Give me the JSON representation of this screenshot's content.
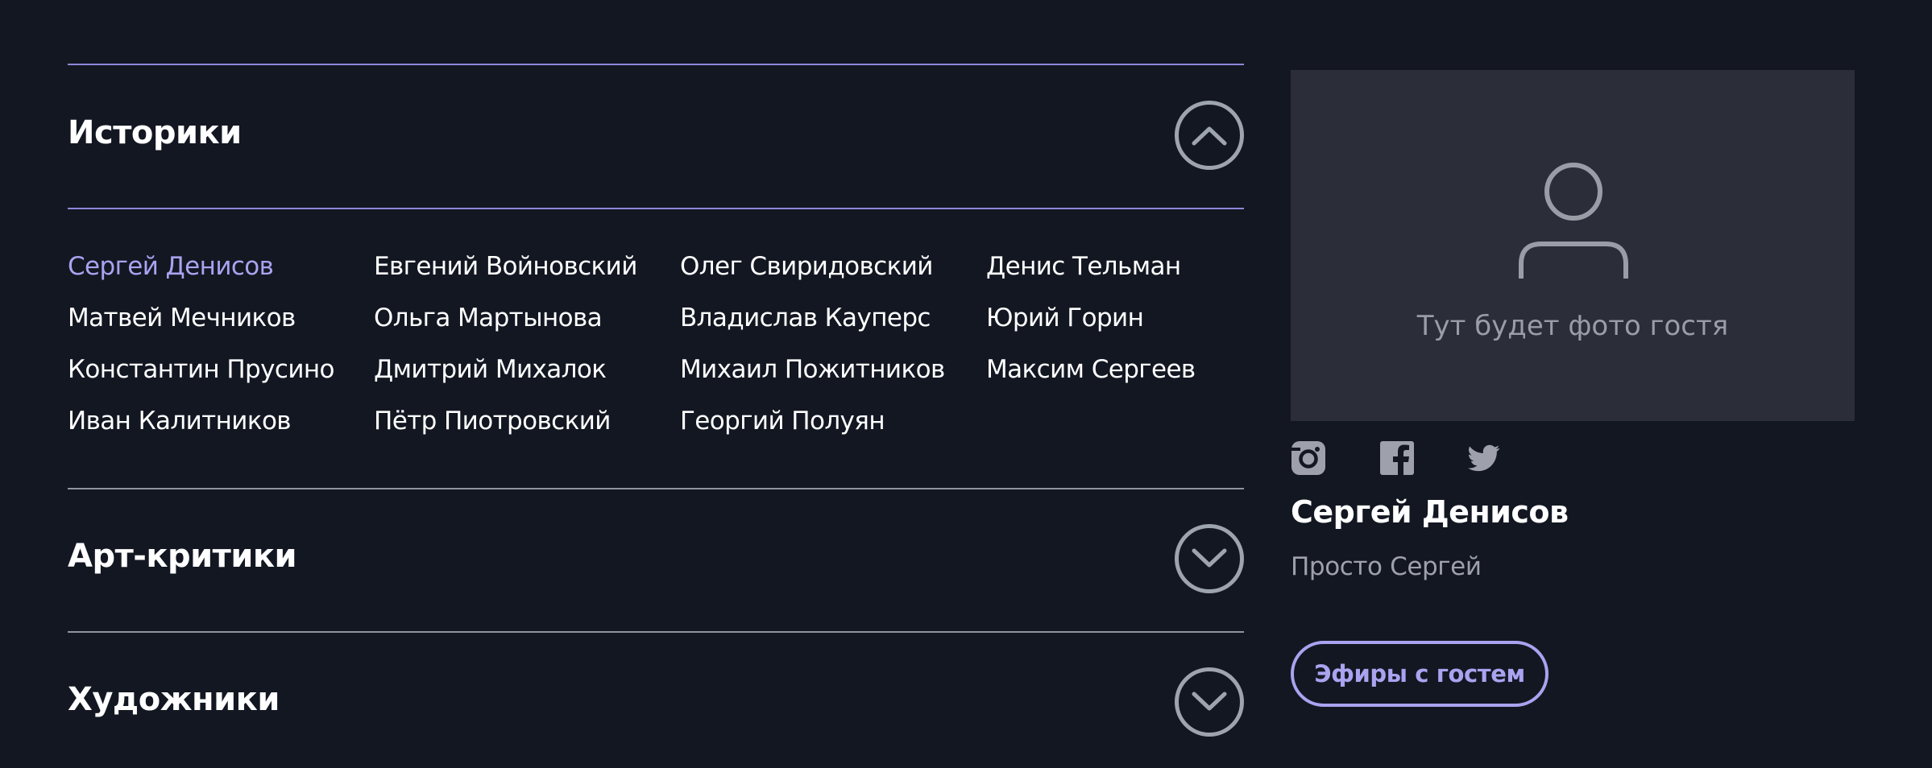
{
  "colors": {
    "background": "#131722",
    "accent": "#a9a3f0",
    "divider_accent": "#8d87d8",
    "divider": "#8f95a0",
    "photo_placeholder_bg": "#2b2d38"
  },
  "sections": [
    {
      "title": "Историки",
      "expanded": true,
      "toggle_icon": "chevron-up-icon"
    },
    {
      "title": "Арт-критики",
      "expanded": false,
      "toggle_icon": "chevron-down-icon"
    },
    {
      "title": "Художники",
      "expanded": false,
      "toggle_icon": "chevron-down-icon"
    }
  ],
  "historians": [
    "Сергей Денисов",
    "Евгений Войновский",
    "Олег Свиридовский",
    "Денис Тельман",
    "Матвей Мечников",
    "Ольга Мартынова",
    "Владислав Кауперс",
    "Юрий Горин",
    "Константин Прусино",
    "Дмитрий Михалок",
    "Михаил Пожитников",
    "Максим Сергеев",
    "Иван Калитников",
    "Пётр Пиотровский",
    "Георгий Полуян"
  ],
  "guest": {
    "photo_placeholder": "Тут будет фото гостя",
    "photo_icon": "user-silhouette-icon",
    "socials": [
      "instagram-icon",
      "facebook-icon",
      "twitter-icon"
    ],
    "name": "Сергей Денисов",
    "subtitle": "Просто Сергей",
    "button_label": "Эфиры с гостем"
  }
}
